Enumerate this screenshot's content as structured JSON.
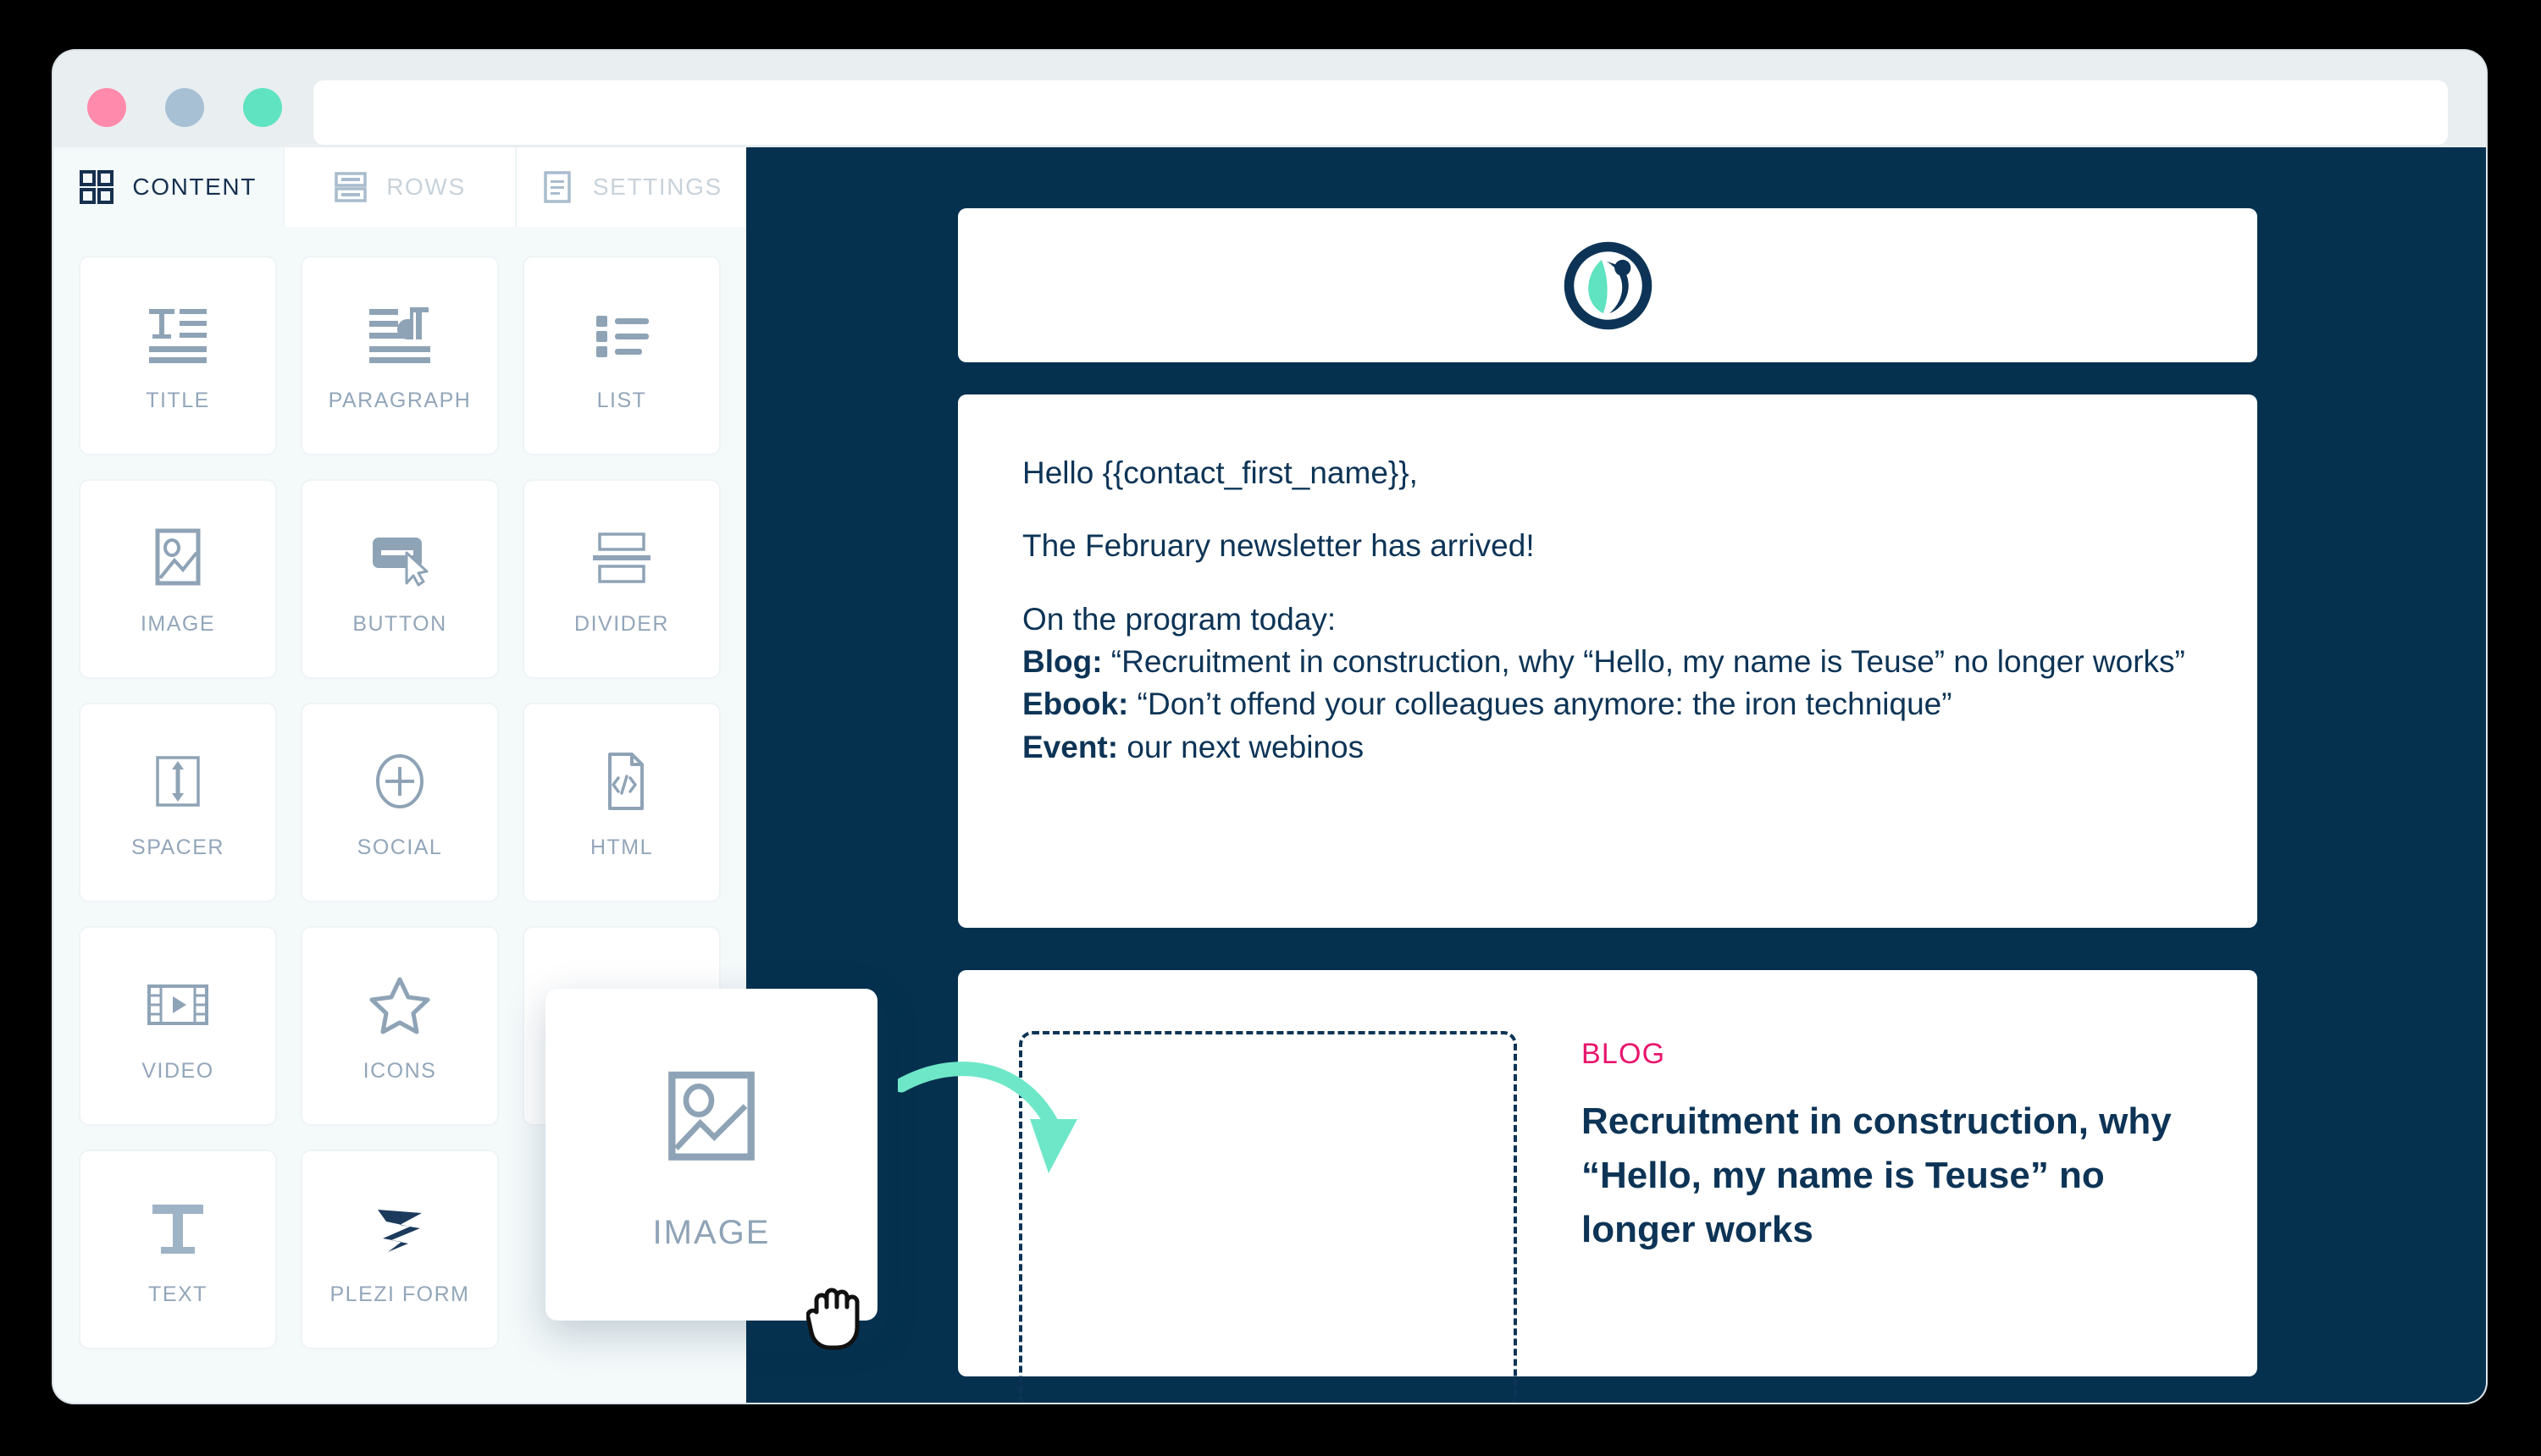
{
  "window": {
    "traffic_lights": [
      "close",
      "minimize",
      "maximize"
    ],
    "url_value": "",
    "url_placeholder": ""
  },
  "sidebar": {
    "tabs": [
      {
        "label": "CONTENT",
        "icon": "grid-icon",
        "active": true
      },
      {
        "label": "ROWS",
        "icon": "rows-icon",
        "active": false
      },
      {
        "label": "SETTINGS",
        "icon": "settings-document-icon",
        "active": false
      }
    ],
    "blocks": [
      {
        "label": "TITLE",
        "icon": "title-icon"
      },
      {
        "label": "PARAGRAPH",
        "icon": "paragraph-icon"
      },
      {
        "label": "LIST",
        "icon": "list-icon"
      },
      {
        "label": "IMAGE",
        "icon": "image-icon"
      },
      {
        "label": "BUTTON",
        "icon": "button-icon"
      },
      {
        "label": "DIVIDER",
        "icon": "divider-icon"
      },
      {
        "label": "SPACER",
        "icon": "spacer-icon"
      },
      {
        "label": "SOCIAL",
        "icon": "social-plus-icon"
      },
      {
        "label": "HTML",
        "icon": "html-code-icon"
      },
      {
        "label": "VIDEO",
        "icon": "video-icon"
      },
      {
        "label": "ICONS",
        "icon": "star-icon"
      },
      {
        "label": "",
        "icon": ""
      },
      {
        "label": "TEXT",
        "icon": "text-t-icon"
      },
      {
        "label": "PLEZI FORM",
        "icon": "plezi-logo-icon"
      }
    ]
  },
  "drag": {
    "ghost_label": "IMAGE",
    "ghost_icon": "image-icon",
    "cursor": "grab-hand-cursor",
    "arrow": "curved-arrow-icon"
  },
  "preview": {
    "logo": "plezi-circle-leaf-logo",
    "email_body": {
      "greeting": "Hello {{contact_first_name}},",
      "intro": " The February newsletter has arrived!",
      "program_heading": "On the program today:",
      "items": [
        {
          "label": "Blog:",
          "text": " “Recruitment in construction, why “Hello, my name is Teuse” no longer works”"
        },
        {
          "label": "Ebook:",
          "text": " “Don’t offend your colleagues anymore: the iron technique”"
        },
        {
          "label": "Event:",
          "text": " our next webinos"
        }
      ]
    },
    "blog_card": {
      "kicker": "BLOG",
      "title": "Recruitment in construction, why “Hello, my name is Teuse” no longer works",
      "dropzone": "empty-image-dropzone"
    }
  },
  "colors": {
    "preview_bg": "#05314f",
    "accent_navy": "#0d3456",
    "accent_pink": "#e8156b",
    "accent_mint": "#6ee7c8",
    "icon_grey": "#8fa3b6",
    "sidebar_bg": "#f4f9fa",
    "titlebar_bg": "#e9eef1",
    "dot_red": "#ff8aab",
    "dot_amber": "#a8c0d4",
    "dot_green": "#5fe3c0"
  }
}
